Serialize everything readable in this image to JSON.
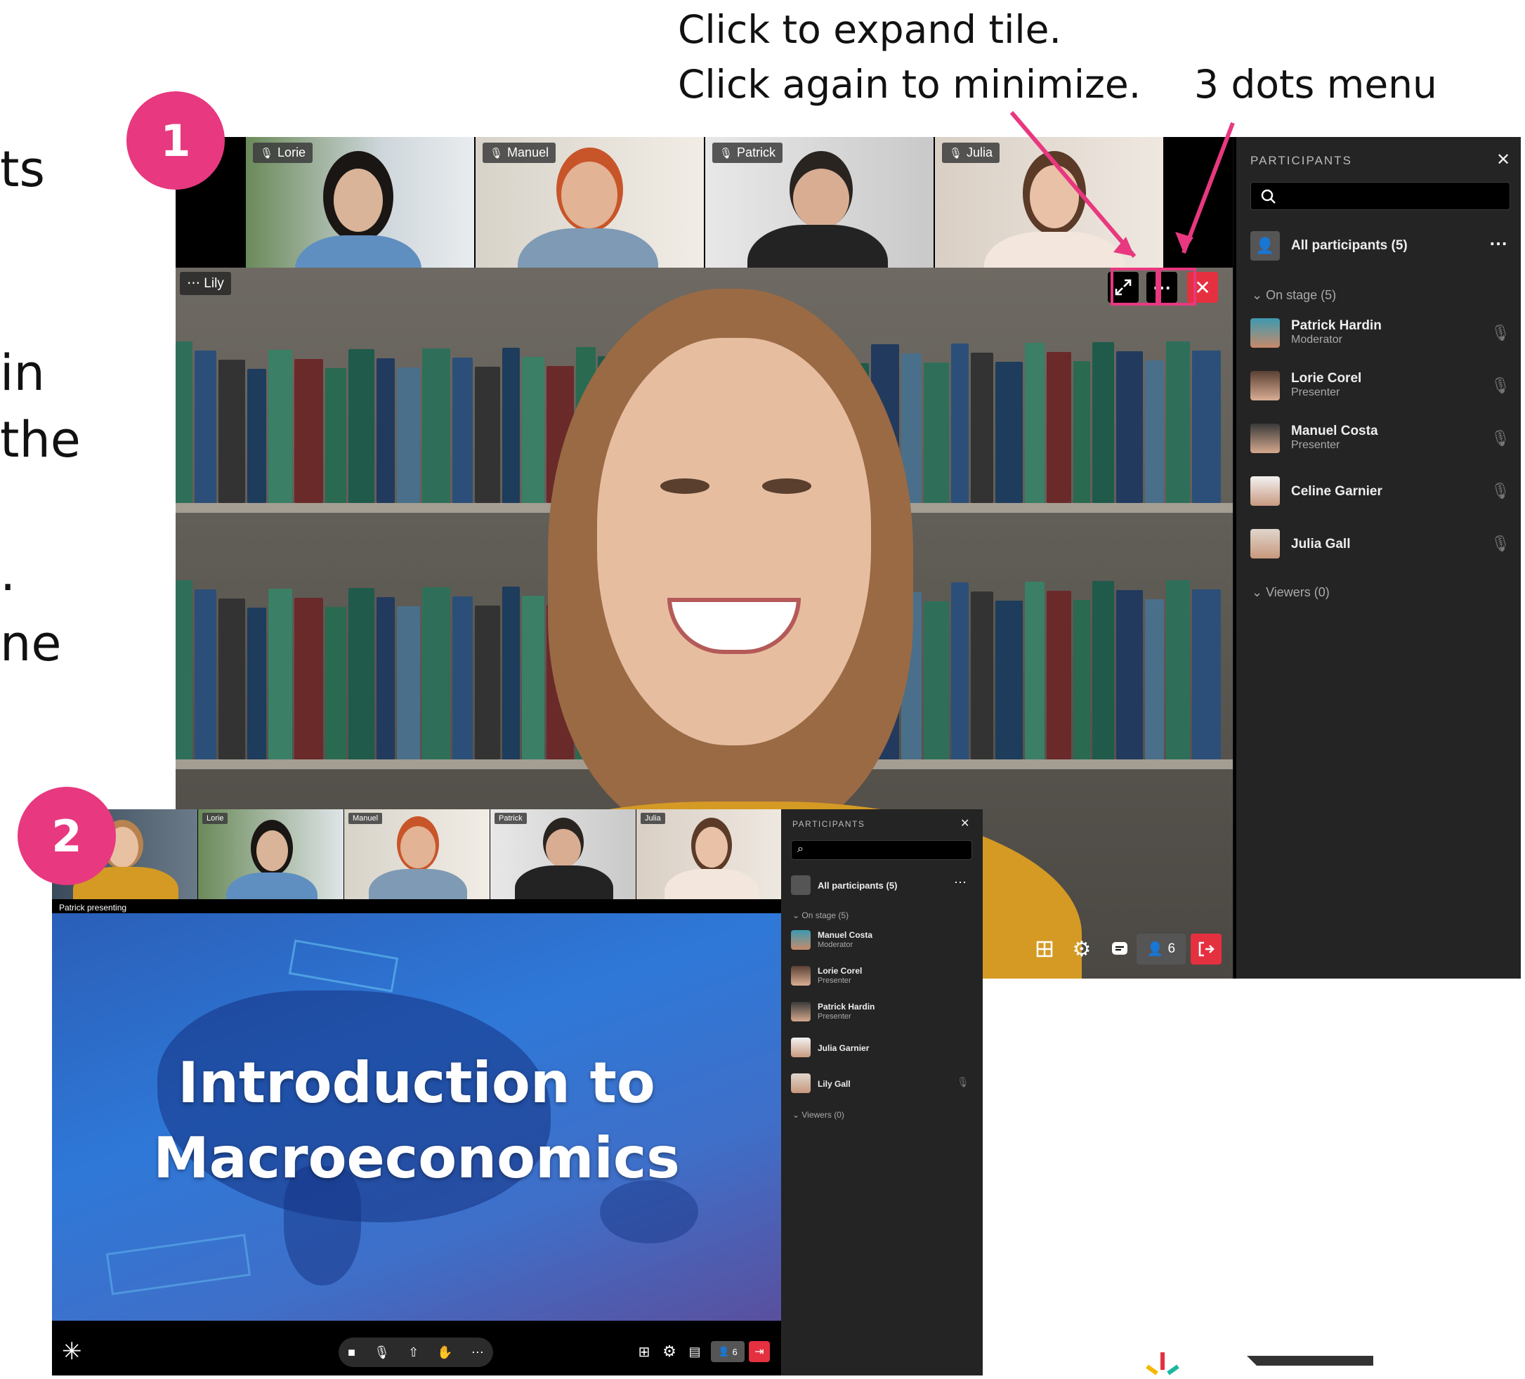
{
  "callouts": {
    "expand_line1": "Click to expand tile.",
    "expand_line2": "Click again to minimize.",
    "dots": "3 dots menu"
  },
  "badges": {
    "one": "1",
    "two": "2"
  },
  "left_text": [
    "ts",
    "in",
    "the",
    ".",
    "ne"
  ],
  "screen1": {
    "thumbnails": [
      {
        "name": "Lorie"
      },
      {
        "name": "Manuel"
      },
      {
        "name": "Patrick"
      },
      {
        "name": "Julia"
      }
    ],
    "stage_name": "Lily",
    "stage_menu_icon": "ellipsis",
    "participant_count": "6",
    "panel": {
      "title": "PARTICIPANTS",
      "all_participants": "All participants (5)",
      "on_stage": "On stage (5)",
      "viewers": "Viewers (0)",
      "people": [
        {
          "name": "Patrick Hardin",
          "role": "Moderator"
        },
        {
          "name": "Lorie Corel",
          "role": "Presenter"
        },
        {
          "name": "Manuel Costa",
          "role": "Presenter"
        },
        {
          "name": "Celine Garnier",
          "role": ""
        },
        {
          "name": "Julia Gall",
          "role": ""
        }
      ]
    }
  },
  "screen2": {
    "thumbnails": [
      {
        "name": ""
      },
      {
        "name": "Lorie"
      },
      {
        "name": "Manuel"
      },
      {
        "name": "Patrick"
      },
      {
        "name": "Julia"
      }
    ],
    "presenting": "Patrick presenting",
    "slide_title_line1": "Introduction to",
    "slide_title_line2": "Macroeconomics",
    "participant_count": "6",
    "panel": {
      "title": "PARTICIPANTS",
      "all_participants": "All participants (5)",
      "on_stage": "On stage (5)",
      "viewers": "Viewers (0)",
      "people": [
        {
          "name": "Manuel Costa",
          "role": "Moderator"
        },
        {
          "name": "Lorie Corel",
          "role": "Presenter"
        },
        {
          "name": "Patrick Hardin",
          "role": "Presenter"
        },
        {
          "name": "Julia Garnier",
          "role": ""
        },
        {
          "name": "Lily Gall",
          "role": ""
        }
      ]
    }
  },
  "colors": {
    "accent": "#e8387f",
    "danger": "#e5303f",
    "panel": "#242424"
  }
}
